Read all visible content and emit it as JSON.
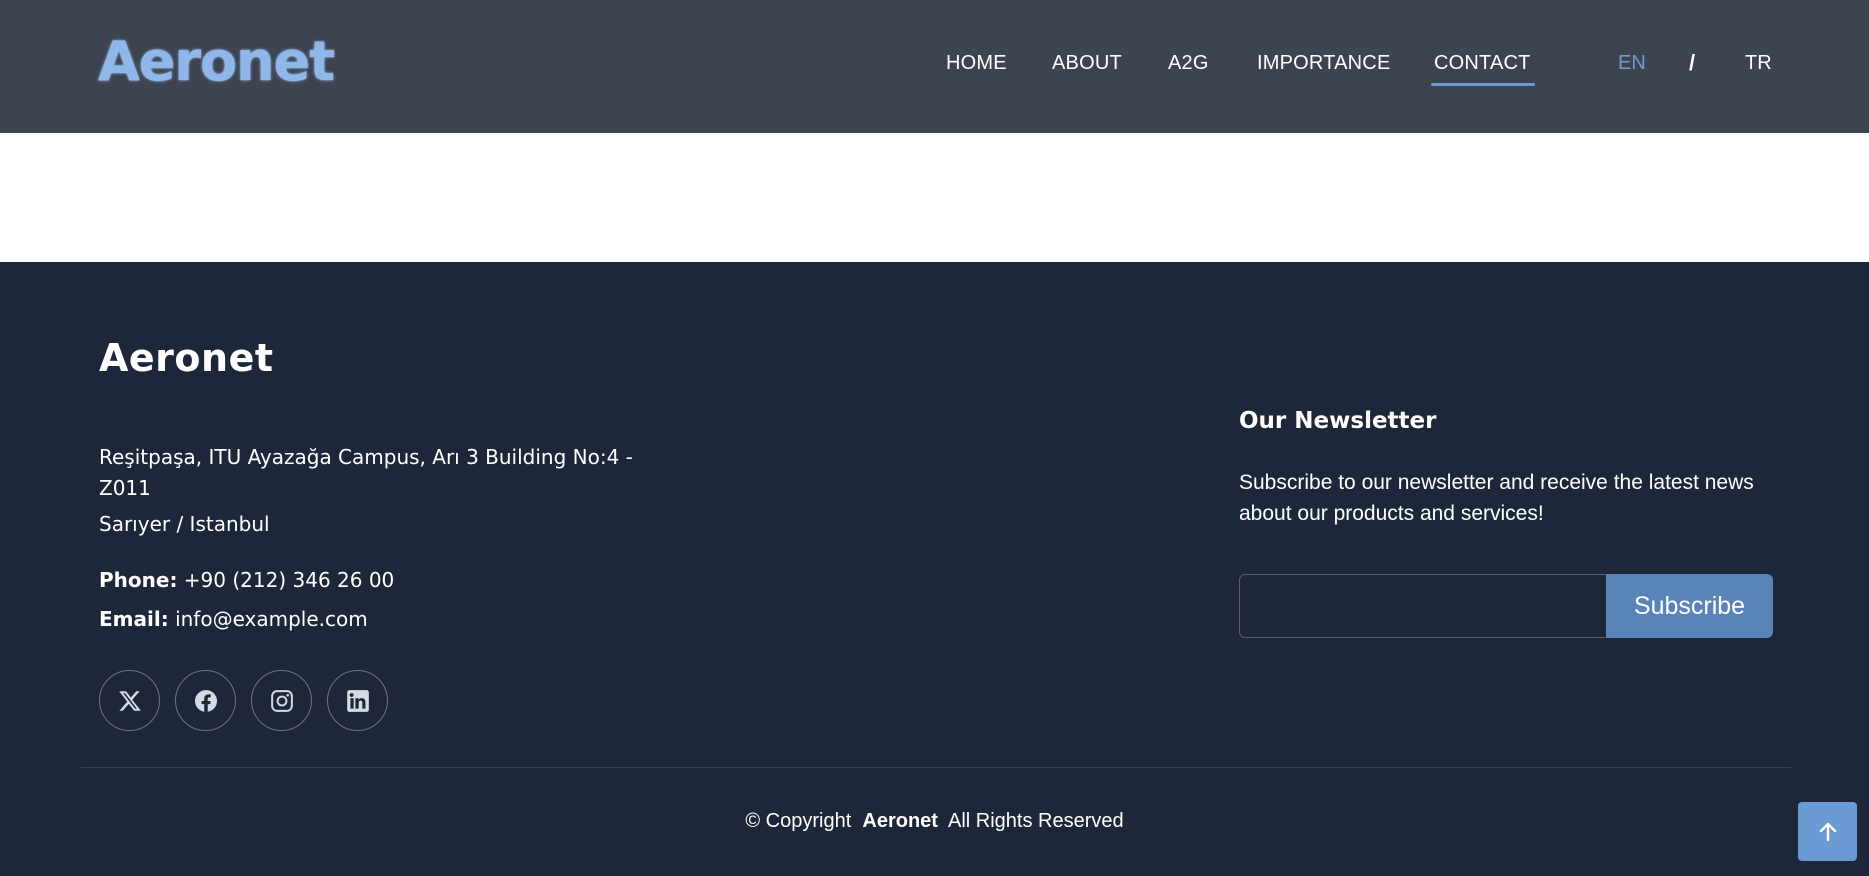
{
  "header": {
    "logo": "Aeronet",
    "nav": [
      {
        "label": "HOME",
        "active": false
      },
      {
        "label": "ABOUT",
        "active": false
      },
      {
        "label": "A2G",
        "active": false
      },
      {
        "label": "IMPORTANCE",
        "active": false
      },
      {
        "label": "CONTACT",
        "active": true
      }
    ],
    "lang": {
      "en": "EN",
      "separator": "/",
      "tr": "TR",
      "selected": "EN"
    }
  },
  "footer": {
    "brand": "Aeronet",
    "address_line": "Reşitpaşa, ITU Ayazağa Campus, Arı 3 Building No:4 - Z011",
    "city": "Sarıyer / Istanbul",
    "phone_label": "Phone:",
    "phone": "+90 (212) 346 26 00",
    "email_label": "Email:",
    "email": "info@example.com",
    "socials": [
      "x-icon",
      "facebook-icon",
      "instagram-icon",
      "linkedin-icon"
    ],
    "newsletter": {
      "title": "Our Newsletter",
      "text": "Subscribe to our newsletter and receive the latest news about our products and services!",
      "input_value": "",
      "button": "Subscribe"
    },
    "copyright": {
      "prefix": "© Copyright",
      "brand": "Aeronet",
      "suffix": "All Rights Reserved"
    }
  },
  "colors": {
    "header_bg": "#3d4450",
    "footer_bg": "#1e2739",
    "accent": "#6e9bd3",
    "button": "#5a83b7"
  },
  "icons": {
    "back_to_top": "arrow-up-icon"
  }
}
